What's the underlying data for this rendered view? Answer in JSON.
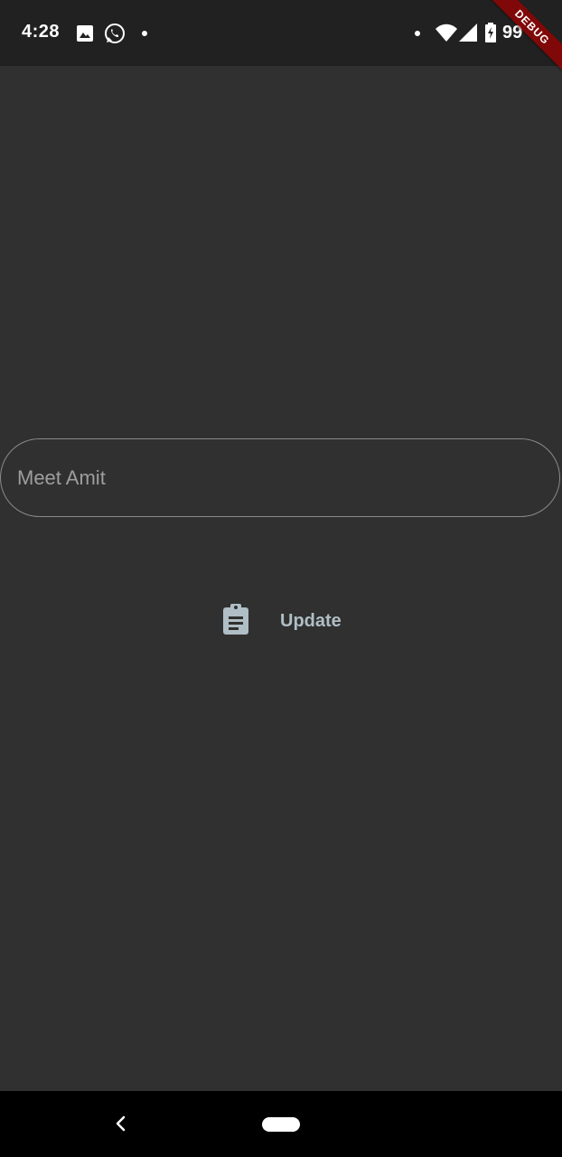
{
  "status_bar": {
    "time": "4:28",
    "battery": "99",
    "icons": [
      "image-icon",
      "whatsapp-icon",
      "notification-dot",
      "wifi-icon",
      "signal-icon",
      "battery-icon"
    ]
  },
  "debug_banner": {
    "label": "DEBUG"
  },
  "main": {
    "text_field": {
      "placeholder": "Meet Amit",
      "value": ""
    },
    "update_button": {
      "label": "Update",
      "icon": "clipboard-icon"
    }
  },
  "nav_bar": {
    "icons": [
      "back-icon",
      "home-pill"
    ]
  },
  "colors": {
    "background": "#303030",
    "status_bar": "#212121",
    "nav_bar": "#000000",
    "field_border": "#8a8a8a",
    "accent": "#b0bec5",
    "debug_banner": "#a00000"
  }
}
